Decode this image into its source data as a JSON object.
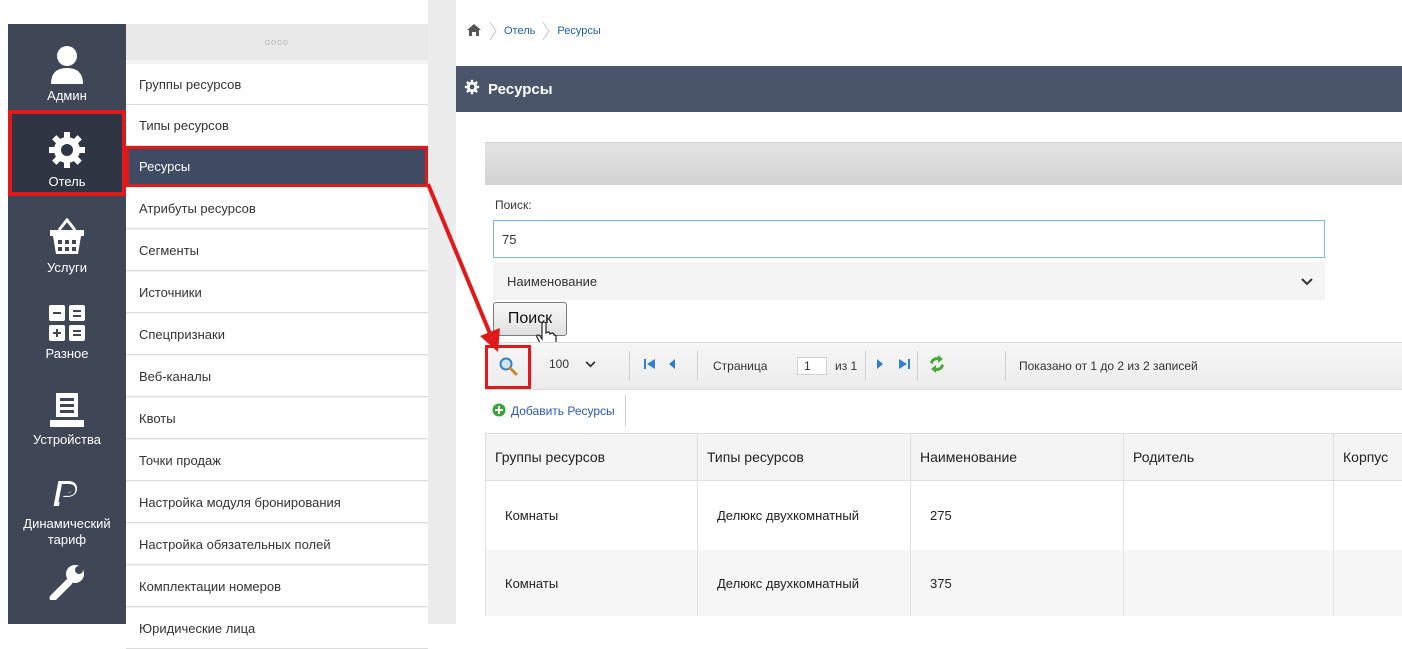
{
  "rail": {
    "items": [
      {
        "label": "Админ",
        "icon": "user-icon"
      },
      {
        "label": "Отель",
        "icon": "gear-icon"
      },
      {
        "label": "Услуги",
        "icon": "basket-icon"
      },
      {
        "label": "Разное",
        "icon": "apps-icon"
      },
      {
        "label": "Устройства",
        "icon": "printer-icon"
      },
      {
        "label": "Динамический тариф",
        "icon": "p-logo-icon"
      },
      {
        "label": "",
        "icon": "wrench-icon"
      }
    ]
  },
  "submenu": {
    "handle": "oooo",
    "items": [
      "Группы ресурсов",
      "Типы ресурсов",
      "Ресурсы",
      "Атрибуты ресурсов",
      "Сегменты",
      "Источники",
      "Спецпризнаки",
      "Веб-каналы",
      "Квоты",
      "Точки продаж",
      "Настройка модуля бронирования",
      "Настройка обязательных полей",
      "Комплектации номеров",
      "Юридические лица"
    ]
  },
  "breadcrumb": {
    "items": [
      "Отель",
      "Ресурсы"
    ],
    "home_icon": "home-icon"
  },
  "header": {
    "title": "Ресурсы"
  },
  "search": {
    "label": "Поиск:",
    "value": "75",
    "field": "Наименование",
    "button": "Поиск"
  },
  "pager": {
    "page_size": "100",
    "page_word": "Страница",
    "page": "1",
    "of": "из 1",
    "records": "Показано от 1 до 2 из 2 записей"
  },
  "add": {
    "label": "Добавить Ресурсы"
  },
  "table": {
    "columns": [
      "Группы ресурсов",
      "Типы ресурсов",
      "Наименование",
      "Родитель",
      "Корпус"
    ],
    "rows": [
      [
        "Комнаты",
        "Делюкс двухкомнатный",
        "275",
        "",
        ""
      ],
      [
        "Комнаты",
        "Делюкс двухкомнатный",
        "375",
        "",
        ""
      ]
    ]
  },
  "colors": {
    "accent_red": "#e01a1a",
    "header": "#4a556a",
    "rail": "#3f4656",
    "link": "#2a55b5"
  }
}
